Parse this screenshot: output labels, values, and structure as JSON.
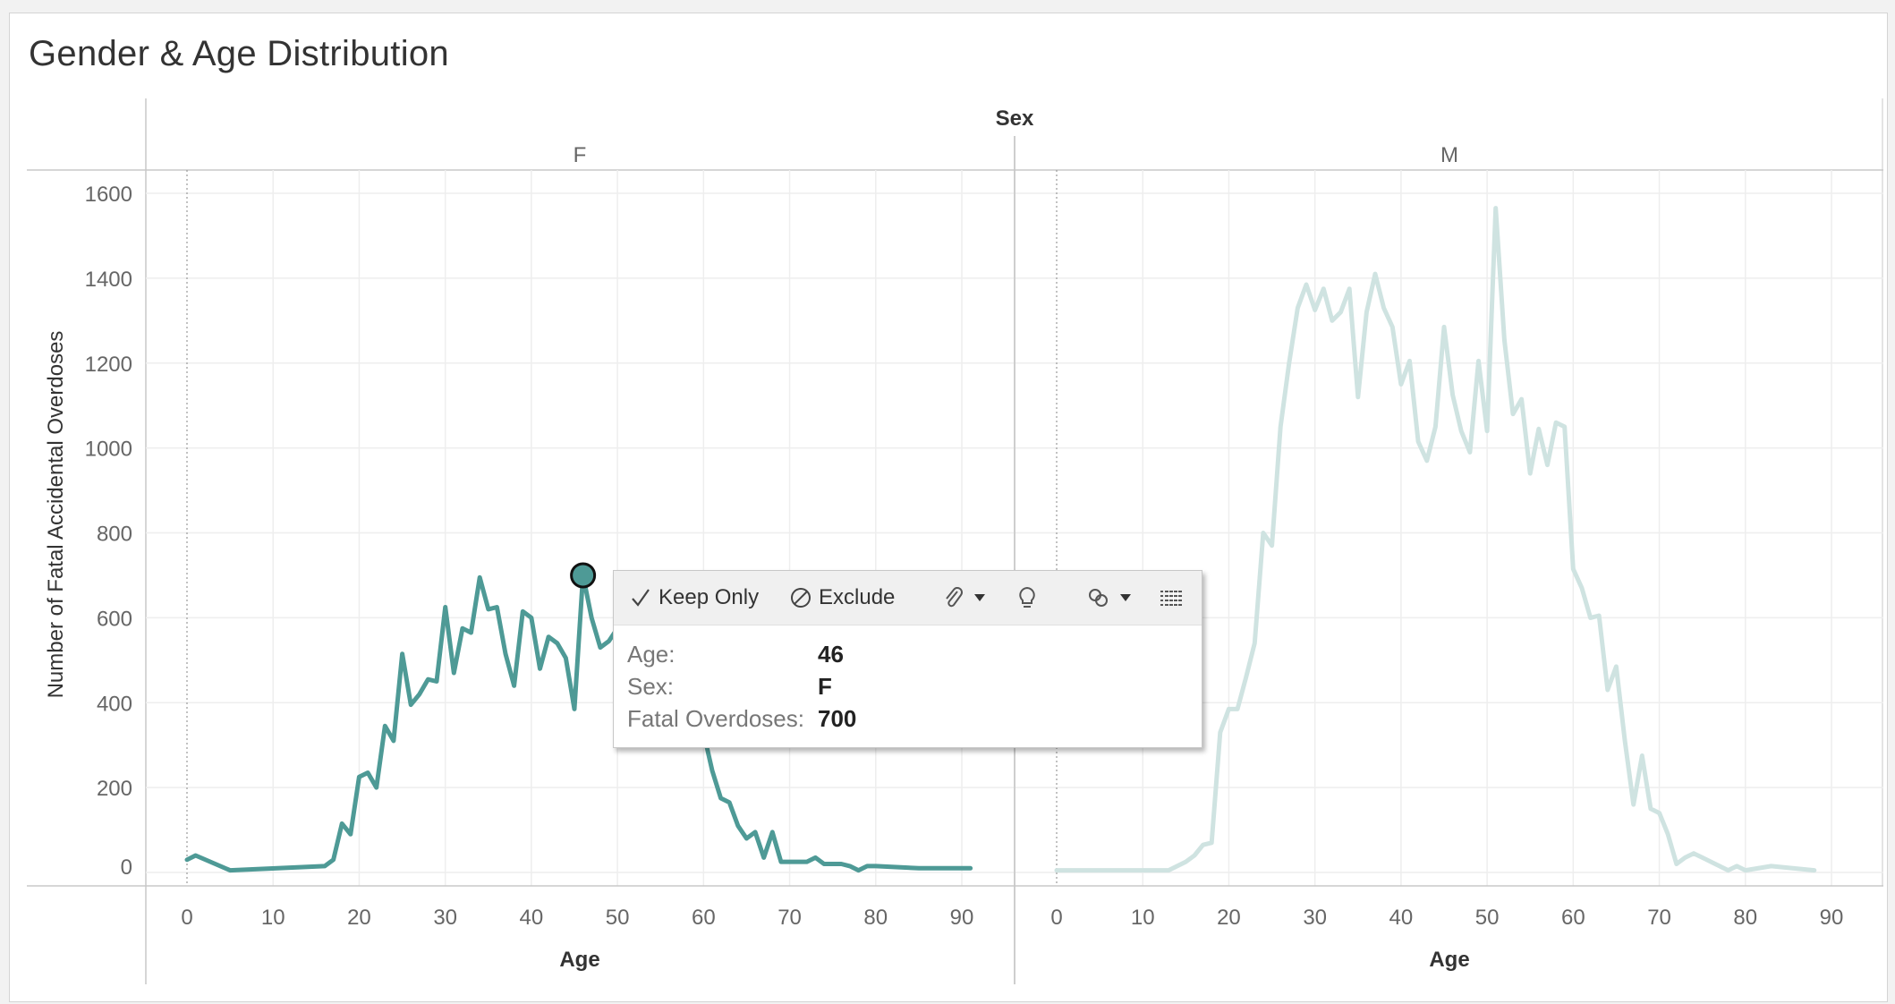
{
  "title": "Gender & Age Distribution",
  "chart_data": {
    "type": "line",
    "title": "Gender & Age Distribution",
    "column_header": "Sex",
    "ylabel": "Number of Fatal Accidental Overdoses",
    "xlabel": "Age",
    "ylim": [
      0,
      1650
    ],
    "yticks": [
      0,
      200,
      400,
      600,
      800,
      1000,
      1200,
      1400,
      1600
    ],
    "xlim": [
      0,
      92
    ],
    "xticks": [
      0,
      10,
      20,
      30,
      40,
      50,
      60,
      70,
      80,
      90
    ],
    "grid": true,
    "panels": [
      {
        "name": "F",
        "color": "#4e9a96",
        "x": [
          0,
          1,
          5,
          16,
          17,
          18,
          19,
          20,
          21,
          22,
          23,
          24,
          25,
          26,
          27,
          28,
          29,
          30,
          31,
          32,
          33,
          34,
          35,
          36,
          37,
          38,
          39,
          40,
          41,
          42,
          43,
          44,
          45,
          46,
          47,
          48,
          49,
          50,
          51,
          52,
          53,
          54,
          55,
          56,
          57,
          58,
          59,
          60,
          61,
          62,
          63,
          64,
          65,
          66,
          67,
          68,
          69,
          70,
          71,
          72,
          73,
          74,
          75,
          76,
          77,
          78,
          79,
          80,
          85,
          91
        ],
        "y": [
          30,
          40,
          5,
          15,
          30,
          115,
          90,
          225,
          235,
          200,
          345,
          310,
          515,
          395,
          420,
          455,
          450,
          625,
          470,
          575,
          565,
          695,
          620,
          625,
          515,
          440,
          615,
          600,
          480,
          555,
          540,
          505,
          385,
          700,
          600,
          530,
          545,
          575,
          585,
          560,
          540,
          530,
          540,
          520,
          480,
          420,
          395,
          330,
          240,
          175,
          165,
          110,
          80,
          95,
          35,
          95,
          25,
          25,
          25,
          25,
          35,
          20,
          20,
          20,
          15,
          5,
          15,
          15,
          10,
          10
        ]
      },
      {
        "name": "M",
        "color": "#cfe3e1",
        "x": [
          0,
          5,
          10,
          13,
          14,
          15,
          16,
          17,
          18,
          19,
          20,
          21,
          22,
          23,
          24,
          25,
          26,
          27,
          28,
          29,
          30,
          31,
          32,
          33,
          34,
          35,
          36,
          37,
          38,
          39,
          40,
          41,
          42,
          43,
          44,
          45,
          46,
          47,
          48,
          49,
          50,
          51,
          52,
          53,
          54,
          55,
          56,
          57,
          58,
          59,
          60,
          61,
          62,
          63,
          64,
          65,
          66,
          67,
          68,
          69,
          70,
          71,
          72,
          73,
          74,
          75,
          76,
          77,
          78,
          79,
          80,
          83,
          88
        ],
        "y": [
          5,
          5,
          5,
          5,
          15,
          25,
          40,
          65,
          70,
          330,
          385,
          385,
          460,
          540,
          800,
          770,
          1050,
          1200,
          1330,
          1385,
          1325,
          1375,
          1300,
          1320,
          1375,
          1120,
          1320,
          1410,
          1330,
          1285,
          1150,
          1205,
          1015,
          970,
          1050,
          1285,
          1125,
          1040,
          990,
          1205,
          1040,
          1565,
          1255,
          1080,
          1115,
          940,
          1045,
          960,
          1060,
          1050,
          715,
          670,
          600,
          605,
          430,
          485,
          310,
          160,
          275,
          150,
          140,
          90,
          20,
          35,
          45,
          35,
          25,
          15,
          5,
          15,
          5,
          15,
          5
        ]
      }
    ],
    "highlight": {
      "panel": "F",
      "x": 46,
      "y": 700
    }
  },
  "tooltip": {
    "actions": [
      {
        "icon": "check-icon",
        "label": "Keep Only"
      },
      {
        "icon": "exclude-icon",
        "label": "Exclude"
      }
    ],
    "tools": [
      "paperclip-icon",
      "dropdown-caret-icon",
      "lightbulb-icon",
      "group-icon",
      "dropdown-caret-icon",
      "view-data-icon"
    ],
    "rows": [
      {
        "label": "Age:",
        "value": "46"
      },
      {
        "label": "Sex:",
        "value": "F"
      },
      {
        "label": "Fatal Overdoses:",
        "value": "700"
      }
    ]
  },
  "colors": {
    "accent": "#4e9a96",
    "faded": "#cfe3e1",
    "grid": "#eeeeee"
  }
}
